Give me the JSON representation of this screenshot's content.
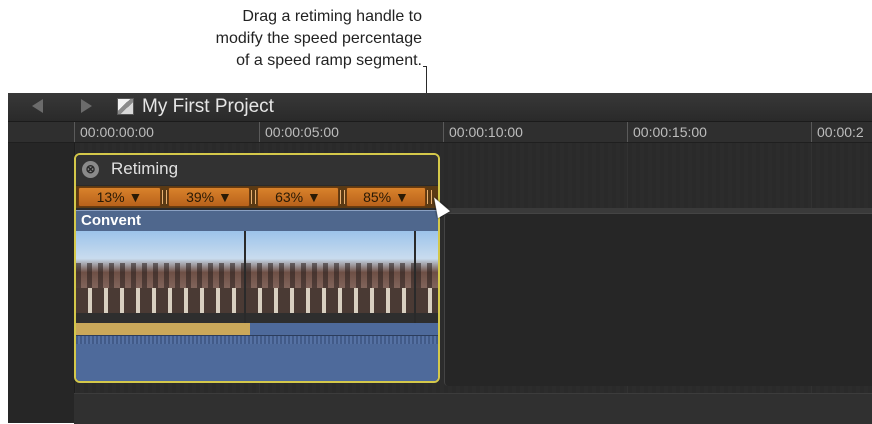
{
  "callout": {
    "line1": "Drag a retiming handle to",
    "line2": "modify the speed percentage",
    "line3": "of a speed ramp segment."
  },
  "project": {
    "title": "My First Project"
  },
  "ruler": {
    "timecodes": [
      "00:00:00:00",
      "00:00:05:00",
      "00:00:10:00",
      "00:00:15:00",
      "00:00:2"
    ]
  },
  "retiming": {
    "label": "Retiming",
    "segments": [
      "13% ▼",
      "39% ▼",
      "63% ▼",
      "85% ▼"
    ]
  },
  "clip": {
    "name": "Convent"
  },
  "icons": {
    "close": "⊗",
    "back": "back-arrow-icon",
    "forward": "forward-arrow-icon"
  },
  "colors": {
    "selection": "#d4c84a",
    "speed_segment": "#d9822b",
    "clip_blue": "#4f678d"
  }
}
